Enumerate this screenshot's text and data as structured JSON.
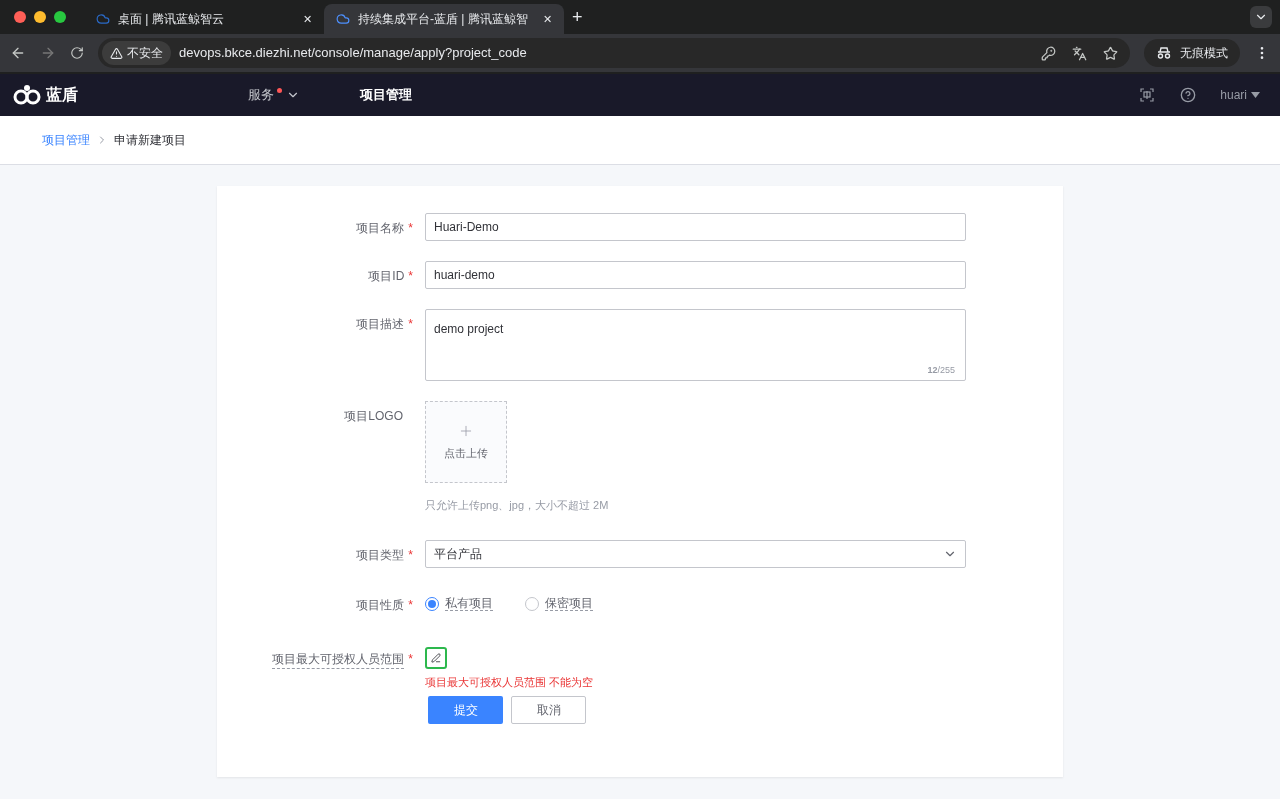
{
  "browser": {
    "tabs": [
      {
        "title": "桌面 | 腾讯蓝鲸智云",
        "selected": false,
        "close": "✕"
      },
      {
        "title": "持续集成平台-蓝盾 | 腾讯蓝鲸智",
        "selected": true,
        "close": "✕"
      }
    ],
    "new_tab": "+",
    "security": "不安全",
    "url": "devops.bkce.diezhi.net/console/manage/apply?project_code",
    "incognito": "无痕模式"
  },
  "app_header": {
    "logo": "蓝盾",
    "nav": [
      {
        "label": "服务",
        "notification": true,
        "dropdown": true
      },
      {
        "label": "项目管理",
        "notification": false,
        "dropdown": false
      }
    ],
    "user": "huari"
  },
  "breadcrumb": [
    {
      "label": "项目管理",
      "kind": "link"
    },
    {
      "label": "申请新建项目",
      "kind": "current"
    }
  ],
  "form": {
    "fields": [
      {
        "kind": "input",
        "label": "项目名称",
        "required_mark": "*",
        "value": "Huari-Demo"
      },
      {
        "kind": "input",
        "label": "项目ID",
        "required_mark": "*",
        "value": "huari-demo"
      },
      {
        "kind": "textarea",
        "label": "项目描述",
        "required_mark": "*",
        "value": "demo project",
        "counter": "**12**/255"
      },
      {
        "kind": "upload",
        "label": "项目LOGO",
        "upload_label": "点击上传",
        "hint": "只允许上传png、jpg，大小不超过 2M"
      },
      {
        "kind": "select",
        "label": "项目类型",
        "required_mark": "*",
        "value": "平台产品"
      },
      {
        "kind": "radio",
        "label": "项目性质",
        "required_mark": "*",
        "options": [
          {
            "label": "私有项目",
            "selected": true
          },
          {
            "label": "保密项目",
            "selected": false
          }
        ]
      },
      {
        "kind": "edit",
        "label": "项目最大可授权人员范围",
        "required_mark": "*",
        "error": "项目最大可授权人员范围 不能为空"
      }
    ],
    "buttons": [
      {
        "label": "提交",
        "primary": true
      },
      {
        "label": "取消",
        "primary": false
      }
    ]
  }
}
